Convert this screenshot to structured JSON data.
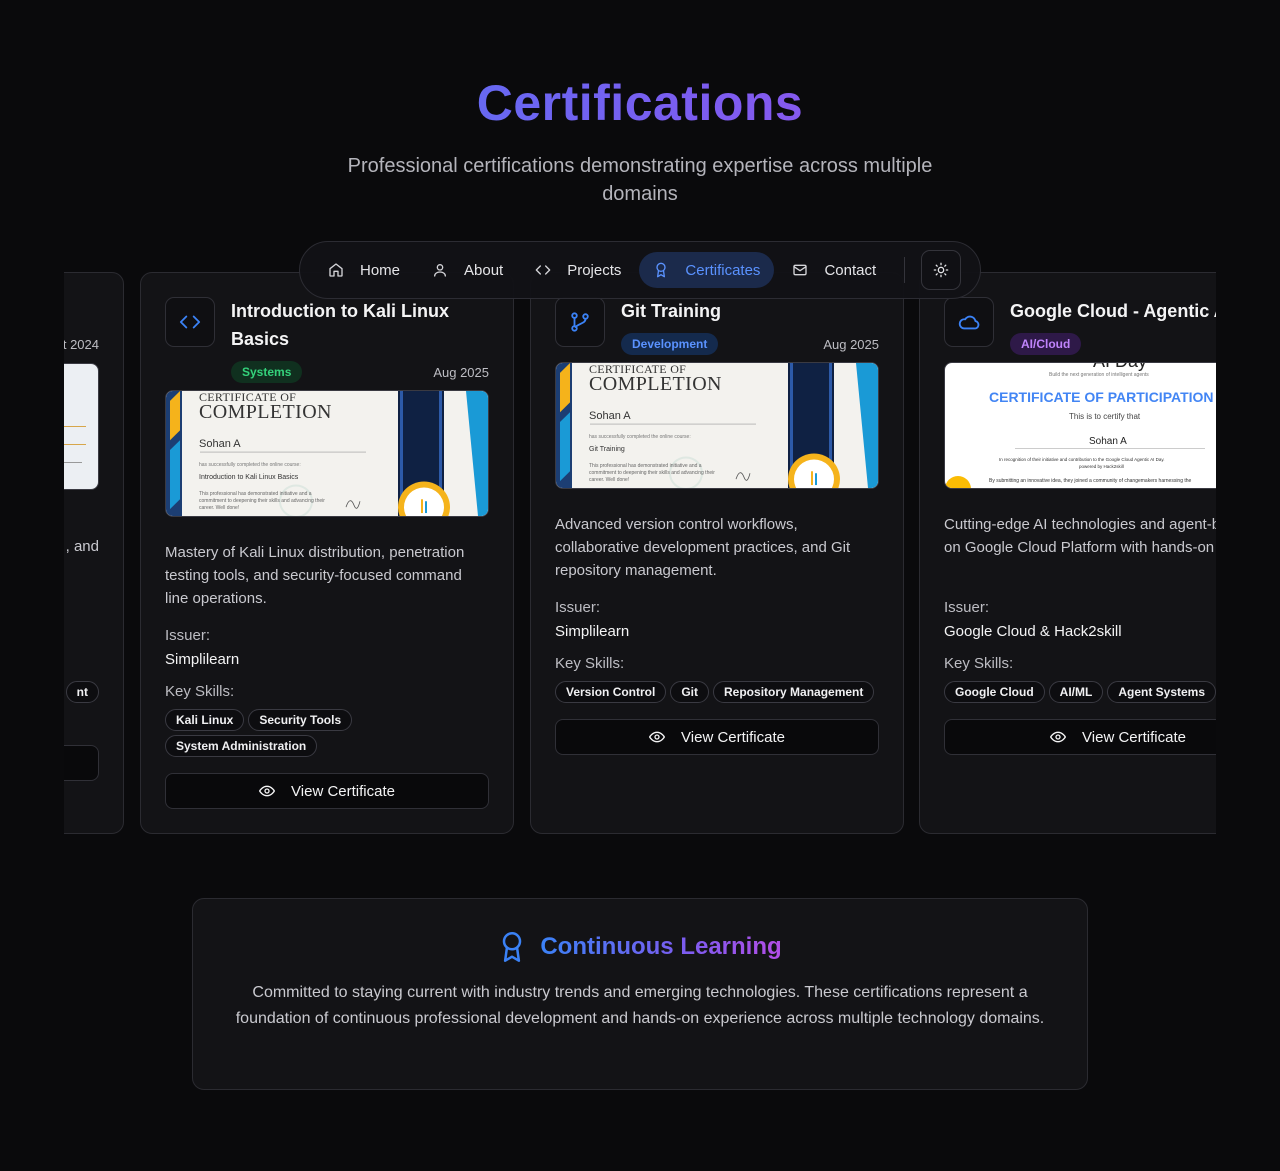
{
  "header": {
    "title": "Certifications",
    "subtitle": "Professional certifications demonstrating expertise across multiple domains"
  },
  "nav": {
    "items": [
      {
        "label": "Home",
        "icon": "home-icon"
      },
      {
        "label": "About",
        "icon": "user-icon"
      },
      {
        "label": "Projects",
        "icon": "code-icon"
      },
      {
        "label": "Certificates",
        "icon": "award-icon",
        "active": true
      },
      {
        "label": "Contact",
        "icon": "mail-icon"
      }
    ],
    "theme_toggle_icon": "sun-icon"
  },
  "partial_card": {
    "date": "t 2024",
    "desc_fragment": ", and",
    "skill_fragment": "nt"
  },
  "cards": [
    {
      "title": "Introduction to Kali Linux Basics",
      "badge": "Systems",
      "date": "Aug 2025",
      "description": "Mastery of Kali Linux distribution, penetration testing tools, and security-focused command line operations.",
      "issuer_label": "Issuer:",
      "issuer": "Simplilearn",
      "skills_label": "Key Skills:",
      "skills": [
        "Kali Linux",
        "Security Tools",
        "System Administration"
      ],
      "button": "View Certificate",
      "cert": {
        "heading1": "CERTIFICATE OF",
        "heading2": "COMPLETION",
        "name": "Sohan A",
        "line": "has successfully completed the online course:",
        "course": "Introduction to Kali Linux Basics",
        "body": "This professional has demonstrated initiative and a commitment to deepening their skills and advancing their career. Well done!"
      }
    },
    {
      "title": "Git Training",
      "badge": "Development",
      "date": "Aug 2025",
      "description": "Advanced version control workflows, collaborative development practices, and Git repository management.",
      "issuer_label": "Issuer:",
      "issuer": "Simplilearn",
      "skills_label": "Key Skills:",
      "skills": [
        "Version Control",
        "Git",
        "Repository Management"
      ],
      "button": "View Certificate",
      "cert": {
        "heading1": "CERTIFICATE OF",
        "heading2": "COMPLETION",
        "name": "Sohan A",
        "line": "has successfully completed the online course:",
        "course": "Git Training",
        "body": "This professional has demonstrated initiative and a commitment to deepening their skills and advancing their career. Well done!"
      }
    },
    {
      "title": "Google Cloud - Agentic AI",
      "badge": "AI/Cloud",
      "date": "",
      "description": "Cutting-edge AI technologies and agent-based systems on Google Cloud Platform with hands-on implementation.",
      "issuer_label": "Issuer:",
      "issuer": "Google Cloud & Hack2skill",
      "skills_label": "Key Skills:",
      "skills": [
        "Google Cloud",
        "AI/ML",
        "Agent Systems"
      ],
      "button": "View Certificate",
      "cert": {
        "event": "AI Day",
        "tagline": "Build the next generation of intelligent agents",
        "heading": "CERTIFICATE OF PARTICIPATION",
        "certify": "This is to certify that",
        "name": "Sohan A",
        "line1": "In recognition of their initiative and contribution to the Google Cloud Agentic AI Day.",
        "line2": "powered by Hack2skill",
        "line3": "By submitting an innovative idea, they joined a community of changemakers harnessing the"
      }
    }
  ],
  "learning": {
    "title": "Continuous Learning",
    "text": "Committed to staying current with industry trends and emerging technologies. These certifications represent a foundation of continuous professional development and hands-on experience across multiple technology domains."
  },
  "colors": {
    "accent_blue": "#3b82f6",
    "accent_purple": "#b34ee6",
    "background": "#0a0a0c",
    "card": "#131316"
  }
}
